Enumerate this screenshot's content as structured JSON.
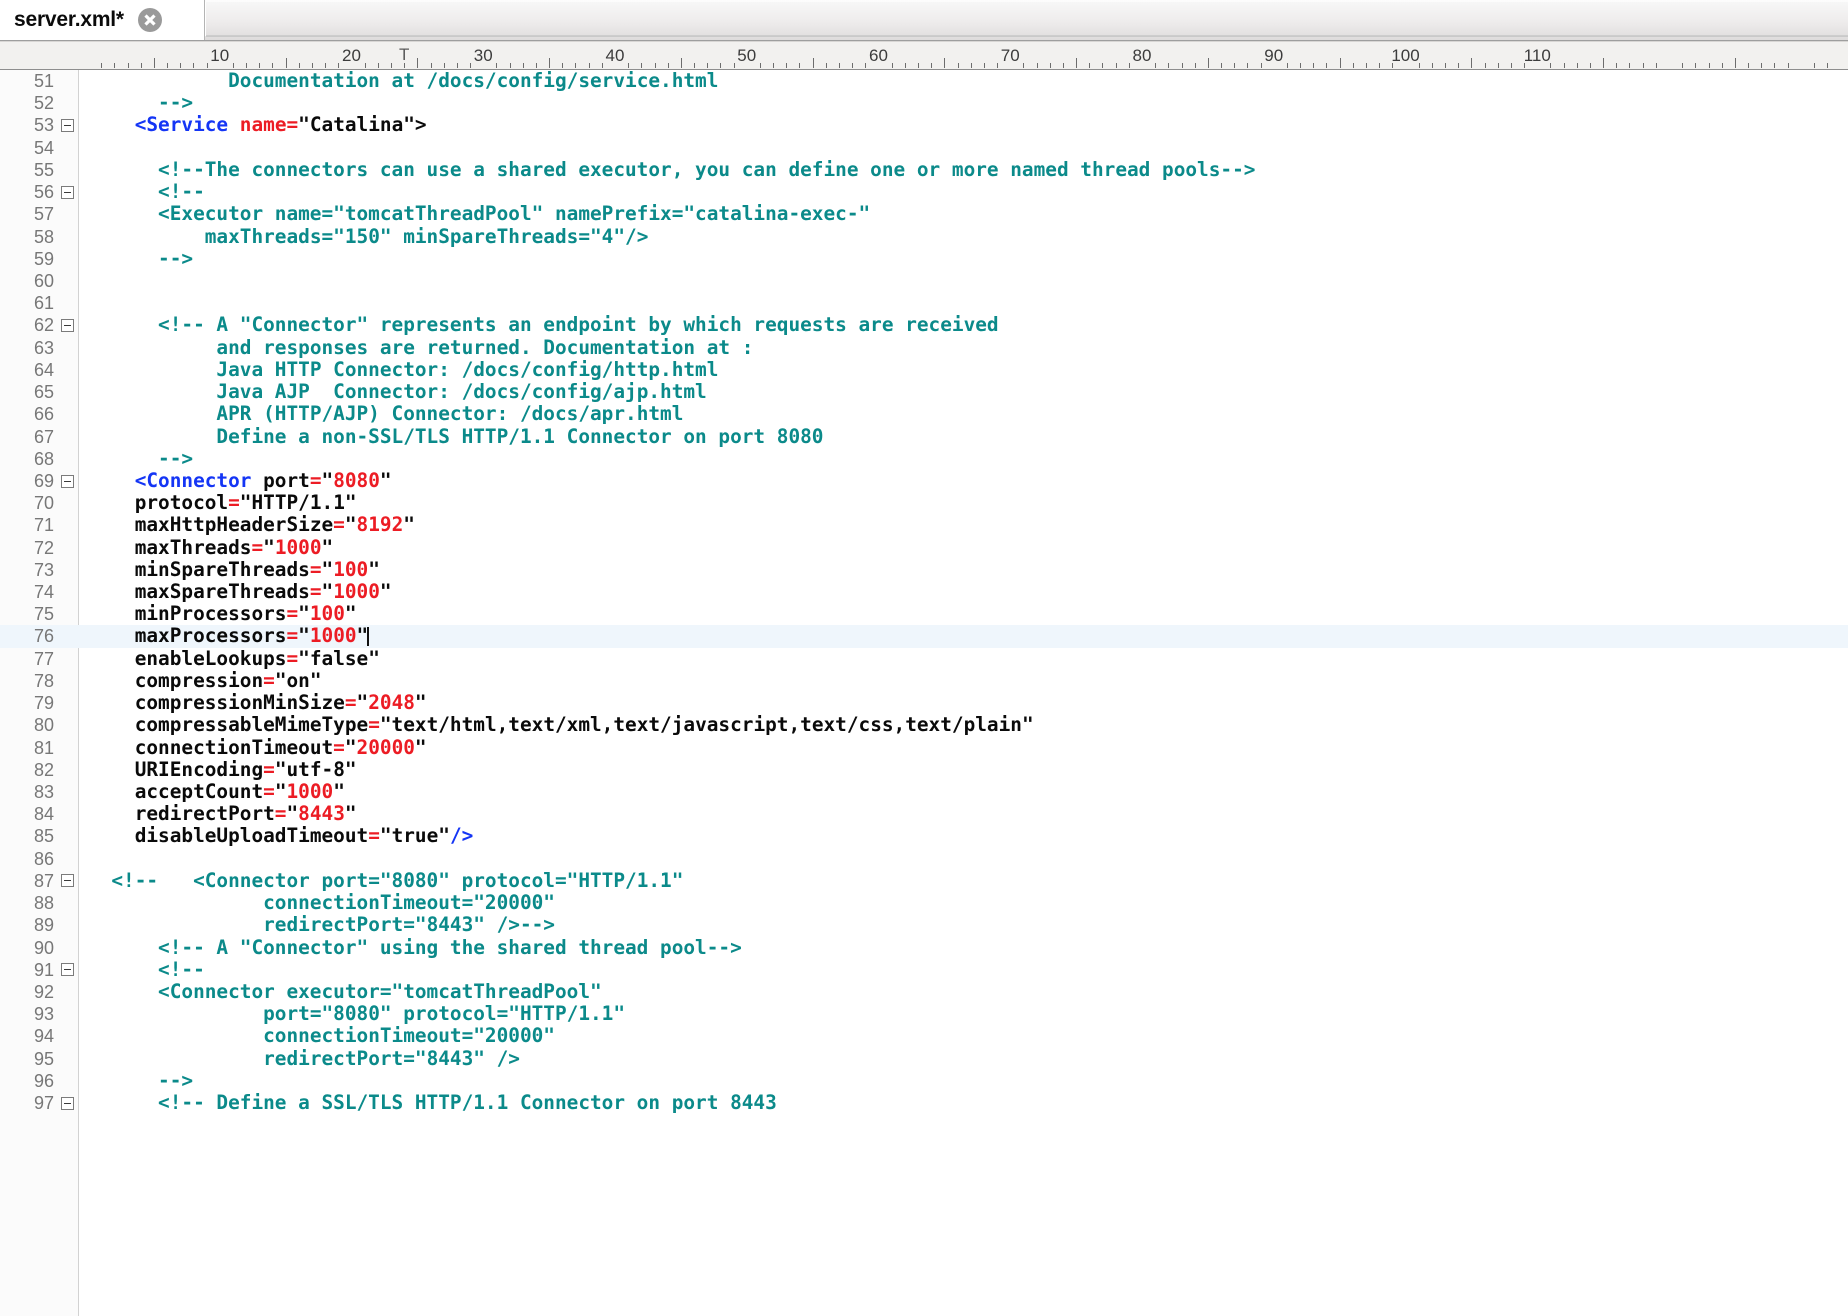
{
  "window": {
    "title": "server.xml*"
  },
  "tabbar": {
    "tabs": [
      {
        "label": "server.xml*",
        "modified": true,
        "active": true,
        "close_icon": "close-circle-icon"
      }
    ]
  },
  "ruler": {
    "labels": [
      "10",
      "20",
      "30",
      "40",
      "50",
      "60",
      "70",
      "80",
      "90",
      "100",
      "110"
    ],
    "tab_stop_marker": "T",
    "tab_stop_column": 24,
    "unit": "columns",
    "major_every": 10,
    "mid_every": 5
  },
  "editor": {
    "language": "xml",
    "current_line": 76,
    "caret_line": 76,
    "caret_column": 26,
    "first_visible_line": 51,
    "last_visible_line": 97,
    "colors": {
      "comment": "#0b8a8a",
      "tag": "#1435f5",
      "attribute_value": "#ec1c24",
      "text": "#0a0a0a",
      "current_line_highlight": "#eff6fc",
      "gutter_bg": "#fbfbfb",
      "gutter_text": "#777777",
      "background": "#ffffff"
    },
    "lines": [
      {
        "n": 51,
        "fold": false,
        "tokens": [
          {
            "t": "            ",
            "c": "bk"
          },
          {
            "t": "Documentation at /docs/config/service.html",
            "c": "cm"
          }
        ]
      },
      {
        "n": 52,
        "fold": false,
        "tokens": [
          {
            "t": "      ",
            "c": "bk"
          },
          {
            "t": "-->",
            "c": "cm"
          }
        ]
      },
      {
        "n": 53,
        "fold": true,
        "tokens": [
          {
            "t": "    ",
            "c": "bk"
          },
          {
            "t": "<Service",
            "c": "tg"
          },
          {
            "t": " ",
            "c": "bk"
          },
          {
            "t": "name=",
            "c": "at"
          },
          {
            "t": "\"Catalina\">",
            "c": "bk"
          }
        ]
      },
      {
        "n": 54,
        "fold": false,
        "tokens": []
      },
      {
        "n": 55,
        "fold": false,
        "tokens": [
          {
            "t": "      ",
            "c": "bk"
          },
          {
            "t": "<!--The connectors can use a shared executor, you can define one or more named thread pools-->",
            "c": "cm"
          }
        ]
      },
      {
        "n": 56,
        "fold": true,
        "tokens": [
          {
            "t": "      ",
            "c": "bk"
          },
          {
            "t": "<!--",
            "c": "cm"
          }
        ]
      },
      {
        "n": 57,
        "fold": false,
        "tokens": [
          {
            "t": "      ",
            "c": "bk"
          },
          {
            "t": "<Executor name=\"tomcatThreadPool\" namePrefix=\"catalina-exec-\"",
            "c": "cm"
          }
        ]
      },
      {
        "n": 58,
        "fold": false,
        "tokens": [
          {
            "t": "          ",
            "c": "bk"
          },
          {
            "t": "maxThreads=\"150\" minSpareThreads=\"4\"/>",
            "c": "cm"
          }
        ]
      },
      {
        "n": 59,
        "fold": false,
        "tokens": [
          {
            "t": "      ",
            "c": "bk"
          },
          {
            "t": "-->",
            "c": "cm"
          }
        ]
      },
      {
        "n": 60,
        "fold": false,
        "tokens": []
      },
      {
        "n": 61,
        "fold": false,
        "tokens": []
      },
      {
        "n": 62,
        "fold": true,
        "tokens": [
          {
            "t": "      ",
            "c": "bk"
          },
          {
            "t": "<!-- A \"Connector\" represents an endpoint by which requests are received",
            "c": "cm"
          }
        ]
      },
      {
        "n": 63,
        "fold": false,
        "tokens": [
          {
            "t": "           ",
            "c": "bk"
          },
          {
            "t": "and responses are returned. Documentation at :",
            "c": "cm"
          }
        ]
      },
      {
        "n": 64,
        "fold": false,
        "tokens": [
          {
            "t": "           ",
            "c": "bk"
          },
          {
            "t": "Java HTTP Connector: /docs/config/http.html",
            "c": "cm"
          }
        ]
      },
      {
        "n": 65,
        "fold": false,
        "tokens": [
          {
            "t": "           ",
            "c": "bk"
          },
          {
            "t": "Java AJP  Connector: /docs/config/ajp.html",
            "c": "cm"
          }
        ]
      },
      {
        "n": 66,
        "fold": false,
        "tokens": [
          {
            "t": "           ",
            "c": "bk"
          },
          {
            "t": "APR (HTTP/AJP) Connector: /docs/apr.html",
            "c": "cm"
          }
        ]
      },
      {
        "n": 67,
        "fold": false,
        "tokens": [
          {
            "t": "           ",
            "c": "bk"
          },
          {
            "t": "Define a non-SSL/TLS HTTP/1.1 Connector on port 8080",
            "c": "cm"
          }
        ]
      },
      {
        "n": 68,
        "fold": false,
        "tokens": [
          {
            "t": "      ",
            "c": "bk"
          },
          {
            "t": "-->",
            "c": "cm"
          }
        ]
      },
      {
        "n": 69,
        "fold": true,
        "tokens": [
          {
            "t": "    ",
            "c": "bk"
          },
          {
            "t": "<Connector",
            "c": "tg"
          },
          {
            "t": " port",
            "c": "bk"
          },
          {
            "t": "=",
            "c": "at"
          },
          {
            "t": "\"",
            "c": "bk"
          },
          {
            "t": "8080",
            "c": "at"
          },
          {
            "t": "\"",
            "c": "bk"
          }
        ]
      },
      {
        "n": 70,
        "fold": false,
        "tokens": [
          {
            "t": "    ",
            "c": "bk"
          },
          {
            "t": "protocol",
            "c": "bk"
          },
          {
            "t": "=",
            "c": "at"
          },
          {
            "t": "\"",
            "c": "bk"
          },
          {
            "t": "HTTP/1.1",
            "c": "bk"
          },
          {
            "t": "\"",
            "c": "bk"
          }
        ]
      },
      {
        "n": 71,
        "fold": false,
        "tokens": [
          {
            "t": "    ",
            "c": "bk"
          },
          {
            "t": "maxHttpHeaderSize",
            "c": "bk"
          },
          {
            "t": "=",
            "c": "at"
          },
          {
            "t": "\"",
            "c": "bk"
          },
          {
            "t": "8192",
            "c": "at"
          },
          {
            "t": "\"",
            "c": "bk"
          }
        ]
      },
      {
        "n": 72,
        "fold": false,
        "tokens": [
          {
            "t": "    ",
            "c": "bk"
          },
          {
            "t": "maxThreads",
            "c": "bk"
          },
          {
            "t": "=",
            "c": "at"
          },
          {
            "t": "\"",
            "c": "bk"
          },
          {
            "t": "1000",
            "c": "at"
          },
          {
            "t": "\"",
            "c": "bk"
          }
        ]
      },
      {
        "n": 73,
        "fold": false,
        "tokens": [
          {
            "t": "    ",
            "c": "bk"
          },
          {
            "t": "minSpareThreads",
            "c": "bk"
          },
          {
            "t": "=",
            "c": "at"
          },
          {
            "t": "\"",
            "c": "bk"
          },
          {
            "t": "100",
            "c": "at"
          },
          {
            "t": "\"",
            "c": "bk"
          }
        ]
      },
      {
        "n": 74,
        "fold": false,
        "tokens": [
          {
            "t": "    ",
            "c": "bk"
          },
          {
            "t": "maxSpareThreads",
            "c": "bk"
          },
          {
            "t": "=",
            "c": "at"
          },
          {
            "t": "\"",
            "c": "bk"
          },
          {
            "t": "1000",
            "c": "at"
          },
          {
            "t": "\"",
            "c": "bk"
          }
        ]
      },
      {
        "n": 75,
        "fold": false,
        "tokens": [
          {
            "t": "    ",
            "c": "bk"
          },
          {
            "t": "minProcessors",
            "c": "bk"
          },
          {
            "t": "=",
            "c": "at"
          },
          {
            "t": "\"",
            "c": "bk"
          },
          {
            "t": "100",
            "c": "at"
          },
          {
            "t": "\"",
            "c": "bk"
          }
        ]
      },
      {
        "n": 76,
        "fold": false,
        "current": true,
        "caret": true,
        "tokens": [
          {
            "t": "    ",
            "c": "bk"
          },
          {
            "t": "maxProcessors",
            "c": "bk"
          },
          {
            "t": "=",
            "c": "at"
          },
          {
            "t": "\"",
            "c": "bk"
          },
          {
            "t": "1000",
            "c": "at"
          },
          {
            "t": "\"",
            "c": "bk"
          }
        ]
      },
      {
        "n": 77,
        "fold": false,
        "tokens": [
          {
            "t": "    ",
            "c": "bk"
          },
          {
            "t": "enableLookups",
            "c": "bk"
          },
          {
            "t": "=",
            "c": "at"
          },
          {
            "t": "\"",
            "c": "bk"
          },
          {
            "t": "false",
            "c": "bk"
          },
          {
            "t": "\"",
            "c": "bk"
          }
        ]
      },
      {
        "n": 78,
        "fold": false,
        "tokens": [
          {
            "t": "    ",
            "c": "bk"
          },
          {
            "t": "compression",
            "c": "bk"
          },
          {
            "t": "=",
            "c": "at"
          },
          {
            "t": "\"",
            "c": "bk"
          },
          {
            "t": "on",
            "c": "bk"
          },
          {
            "t": "\"",
            "c": "bk"
          }
        ]
      },
      {
        "n": 79,
        "fold": false,
        "tokens": [
          {
            "t": "    ",
            "c": "bk"
          },
          {
            "t": "compressionMinSize",
            "c": "bk"
          },
          {
            "t": "=",
            "c": "at"
          },
          {
            "t": "\"",
            "c": "bk"
          },
          {
            "t": "2048",
            "c": "at"
          },
          {
            "t": "\"",
            "c": "bk"
          }
        ]
      },
      {
        "n": 80,
        "fold": false,
        "tokens": [
          {
            "t": "    ",
            "c": "bk"
          },
          {
            "t": "compressableMimeType",
            "c": "bk"
          },
          {
            "t": "=",
            "c": "at"
          },
          {
            "t": "\"text/html,text/xml,text/javascript,text/css,text/plain\"",
            "c": "bk"
          }
        ]
      },
      {
        "n": 81,
        "fold": false,
        "tokens": [
          {
            "t": "    ",
            "c": "bk"
          },
          {
            "t": "connectionTimeout",
            "c": "bk"
          },
          {
            "t": "=",
            "c": "at"
          },
          {
            "t": "\"",
            "c": "bk"
          },
          {
            "t": "20000",
            "c": "at"
          },
          {
            "t": "\"",
            "c": "bk"
          }
        ]
      },
      {
        "n": 82,
        "fold": false,
        "tokens": [
          {
            "t": "    ",
            "c": "bk"
          },
          {
            "t": "URIEncoding",
            "c": "bk"
          },
          {
            "t": "=",
            "c": "at"
          },
          {
            "t": "\"",
            "c": "bk"
          },
          {
            "t": "utf-8",
            "c": "bk"
          },
          {
            "t": "\"",
            "c": "bk"
          }
        ]
      },
      {
        "n": 83,
        "fold": false,
        "tokens": [
          {
            "t": "    ",
            "c": "bk"
          },
          {
            "t": "acceptCount",
            "c": "bk"
          },
          {
            "t": "=",
            "c": "at"
          },
          {
            "t": "\"",
            "c": "bk"
          },
          {
            "t": "1000",
            "c": "at"
          },
          {
            "t": "\"",
            "c": "bk"
          }
        ]
      },
      {
        "n": 84,
        "fold": false,
        "tokens": [
          {
            "t": "    ",
            "c": "bk"
          },
          {
            "t": "redirectPort",
            "c": "bk"
          },
          {
            "t": "=",
            "c": "at"
          },
          {
            "t": "\"",
            "c": "bk"
          },
          {
            "t": "8443",
            "c": "at"
          },
          {
            "t": "\"",
            "c": "bk"
          }
        ]
      },
      {
        "n": 85,
        "fold": false,
        "tokens": [
          {
            "t": "    ",
            "c": "bk"
          },
          {
            "t": "disableUploadTimeout",
            "c": "bk"
          },
          {
            "t": "=",
            "c": "at"
          },
          {
            "t": "\"",
            "c": "bk"
          },
          {
            "t": "true",
            "c": "bk"
          },
          {
            "t": "\"",
            "c": "bk"
          },
          {
            "t": "/>",
            "c": "tg"
          }
        ]
      },
      {
        "n": 86,
        "fold": false,
        "tokens": []
      },
      {
        "n": 87,
        "fold": true,
        "tokens": [
          {
            "t": "  ",
            "c": "bk"
          },
          {
            "t": "<!--   <Connector port=\"8080\" protocol=\"HTTP/1.1\"",
            "c": "cm"
          }
        ]
      },
      {
        "n": 88,
        "fold": false,
        "tokens": [
          {
            "t": "               ",
            "c": "bk"
          },
          {
            "t": "connectionTimeout=\"20000\"",
            "c": "cm"
          }
        ]
      },
      {
        "n": 89,
        "fold": false,
        "tokens": [
          {
            "t": "               ",
            "c": "bk"
          },
          {
            "t": "redirectPort=\"8443\" />-->",
            "c": "cm"
          }
        ]
      },
      {
        "n": 90,
        "fold": false,
        "tokens": [
          {
            "t": "      ",
            "c": "bk"
          },
          {
            "t": "<!-- A \"Connector\" using the shared thread pool-->",
            "c": "cm"
          }
        ]
      },
      {
        "n": 91,
        "fold": true,
        "tokens": [
          {
            "t": "      ",
            "c": "bk"
          },
          {
            "t": "<!--",
            "c": "cm"
          }
        ]
      },
      {
        "n": 92,
        "fold": false,
        "tokens": [
          {
            "t": "      ",
            "c": "bk"
          },
          {
            "t": "<Connector executor=\"tomcatThreadPool\"",
            "c": "cm"
          }
        ]
      },
      {
        "n": 93,
        "fold": false,
        "tokens": [
          {
            "t": "               ",
            "c": "bk"
          },
          {
            "t": "port=\"8080\" protocol=\"HTTP/1.1\"",
            "c": "cm"
          }
        ]
      },
      {
        "n": 94,
        "fold": false,
        "tokens": [
          {
            "t": "               ",
            "c": "bk"
          },
          {
            "t": "connectionTimeout=\"20000\"",
            "c": "cm"
          }
        ]
      },
      {
        "n": 95,
        "fold": false,
        "tokens": [
          {
            "t": "               ",
            "c": "bk"
          },
          {
            "t": "redirectPort=\"8443\" />",
            "c": "cm"
          }
        ]
      },
      {
        "n": 96,
        "fold": false,
        "tokens": [
          {
            "t": "      ",
            "c": "bk"
          },
          {
            "t": "-->",
            "c": "cm"
          }
        ]
      },
      {
        "n": 97,
        "fold": true,
        "tokens": [
          {
            "t": "      ",
            "c": "bk"
          },
          {
            "t": "<!-- Define a SSL/TLS HTTP/1.1 Connector on port 8443",
            "c": "cm"
          }
        ]
      }
    ]
  }
}
